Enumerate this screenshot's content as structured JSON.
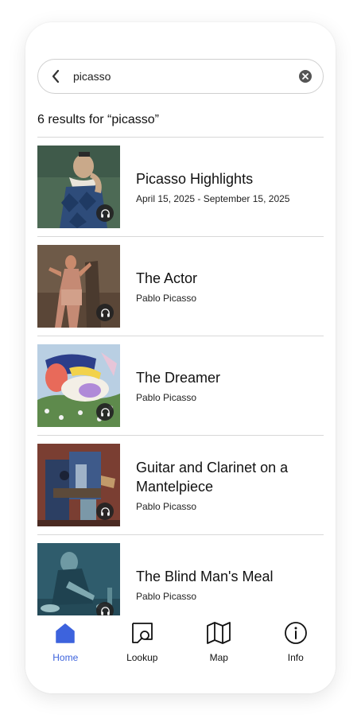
{
  "search": {
    "value": "picasso",
    "placeholder": ""
  },
  "results_label": "6 results for “picasso”",
  "results": [
    {
      "title": "Picasso Highlights",
      "subtitle": "April 15, 2025 - September 15, 2025",
      "icon": "headphones-icon"
    },
    {
      "title": "The Actor",
      "subtitle": "Pablo Picasso",
      "icon": "headphones-icon"
    },
    {
      "title": "The Dreamer",
      "subtitle": "Pablo Picasso",
      "icon": "headphones-icon"
    },
    {
      "title": "Guitar and Clarinet on a Mantelpiece",
      "subtitle": "Pablo Picasso",
      "icon": "headphones-icon"
    },
    {
      "title": "The Blind Man's Meal",
      "subtitle": "Pablo Picasso",
      "icon": "headphones-icon"
    }
  ],
  "tabs": [
    {
      "label": "Home",
      "icon": "home-icon",
      "active": true
    },
    {
      "label": "Lookup",
      "icon": "lookup-icon",
      "active": false
    },
    {
      "label": "Map",
      "icon": "map-icon",
      "active": false
    },
    {
      "label": "Info",
      "icon": "info-icon",
      "active": false
    }
  ],
  "colors": {
    "accent": "#3d63dd",
    "divider": "#d8d8d8",
    "badge": "#232323"
  }
}
